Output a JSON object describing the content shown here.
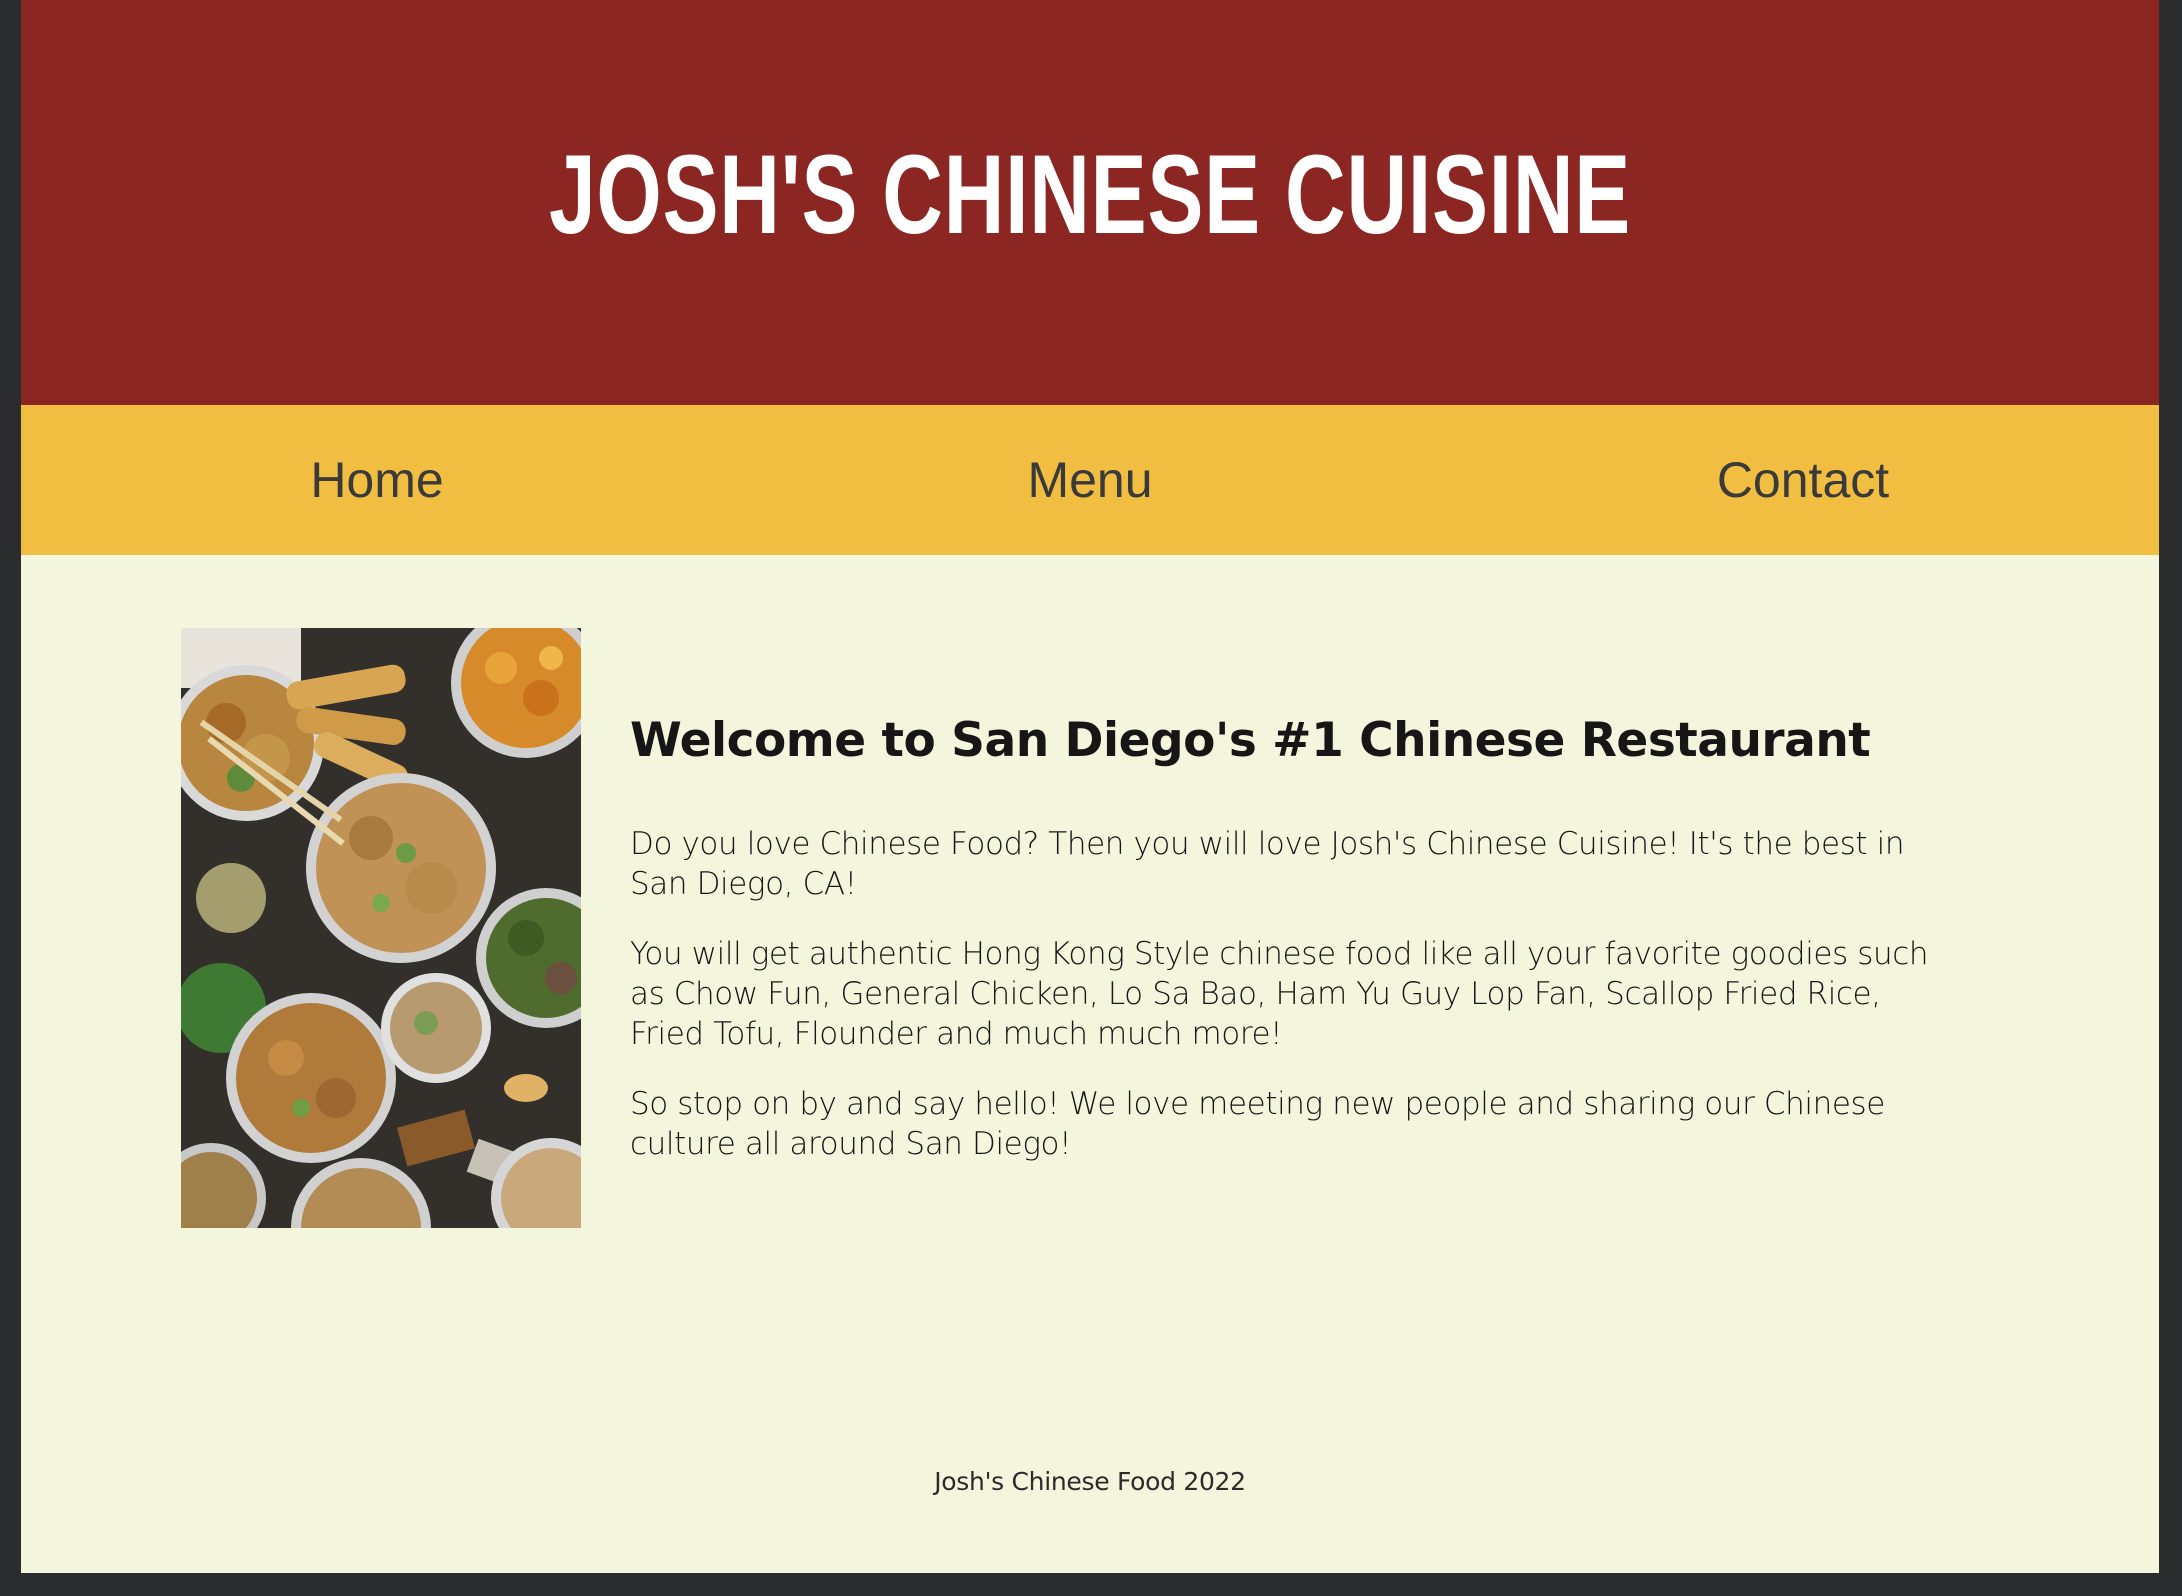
{
  "header": {
    "title": "JOSH'S CHINESE CUISINE"
  },
  "nav": {
    "items": [
      {
        "label": "Home"
      },
      {
        "label": "Menu"
      },
      {
        "label": "Contact"
      }
    ]
  },
  "main": {
    "image": {
      "icon": "food-photo"
    },
    "heading": "Welcome to San Diego's #1 Chinese Restaurant",
    "paragraphs": [
      "Do you love Chinese Food? Then you will love Josh's Chinese Cuisine! It's the best in San Diego, CA!",
      "You will get authentic Hong Kong Style chinese food like all your favorite goodies such as Chow Fun, General Chicken, Lo Sa Bao, Ham Yu Guy Lop Fan, Scallop Fried Rice, Fried Tofu, Flounder and much much more!",
      "So stop on by and say hello! We love meeting new people and sharing our Chinese culture all around San Diego!"
    ]
  },
  "footer": {
    "text": "Josh's Chinese Food 2022"
  },
  "colors": {
    "header_bg": "#8b2623",
    "nav_bg": "#f2be42",
    "page_bg": "#f4f5dd",
    "outer_bg": "#2b2c2e"
  }
}
